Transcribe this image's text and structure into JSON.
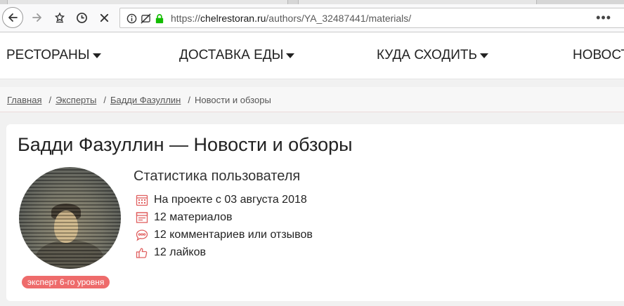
{
  "browser": {
    "url_scheme": "https://",
    "url_host": "chelrestoran.ru",
    "url_path": "/authors/YA_32487441/materials/",
    "more_label": "•••"
  },
  "nav": {
    "items": [
      {
        "label": "РЕСТОРАНЫ"
      },
      {
        "label": "ДОСТАВКА ЕДЫ"
      },
      {
        "label": "КУДА СХОДИТЬ"
      },
      {
        "label": "НОВОСТ"
      }
    ]
  },
  "breadcrumb": {
    "home": "Главная",
    "experts": "Эксперты",
    "author": "Бадди Фазуллин",
    "current": "Новости и обзоры",
    "separator": "/"
  },
  "profile": {
    "title": "Бадди Фазуллин — Новости и обзоры",
    "level_badge": "эксперт 6-го уровня",
    "stats_title": "Статистика пользователя",
    "stats": [
      {
        "icon": "calendar-icon",
        "text": "На проекте с 03 августа 2018"
      },
      {
        "icon": "materials-icon",
        "text": "12 материалов"
      },
      {
        "icon": "comment-icon",
        "text": "12 комментариев или отзывов"
      },
      {
        "icon": "like-icon",
        "text": "12 лайков"
      }
    ]
  },
  "colors": {
    "accent": "#ee6b6b",
    "icon": "#e06060"
  }
}
